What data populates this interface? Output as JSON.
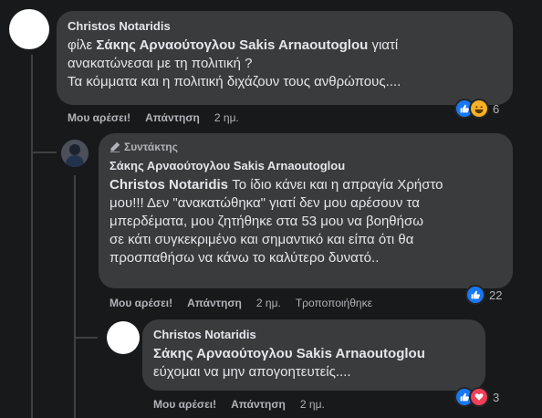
{
  "comment1": {
    "author": "Christos Notaridis",
    "line1_prefix": "φίλε ",
    "line1_mention": "Σάκης Αρναούτογλου Sakis Arnaoutoglou",
    "line1_suffix": " γιατί",
    "line2": "ανακατώνεσαι με τη πολιτική ?",
    "line3": "Τα κόμματα και η πολιτική διχάζουν τους ανθρώπους....",
    "like_label": "Μου αρέσει!",
    "reply_label": "Απάντηση",
    "time": "2 ημ.",
    "reaction_count": "6"
  },
  "reply1": {
    "badge": "Συντάκτης",
    "author": "Σάκης Αρναούτογλου Sakis Arnaoutoglou",
    "mention": "Christos Notaridis",
    "line1_suffix": " Το ίδιο κάνει και η απραγία Χρήστο",
    "line2": "μου!!! Δεν \"ανακατώθηκα\" γιατί δεν μου αρέσουν τα",
    "line3": "μπερδέματα, μου ζητήθηκε στα 53 μου να βοηθήσω",
    "line4": "σε κάτι συγκεκριμένο και σημαντικό και είπα ότι θα",
    "line5": "προσπαθήσω να κάνω το καλύτερο δυνατό..",
    "like_label": "Μου αρέσει!",
    "reply_label": "Απάντηση",
    "time": "2 ημ.",
    "edited": "Τροποποιήθηκε",
    "reaction_count": "22"
  },
  "reply2": {
    "author": "Christos Notaridis",
    "mention": "Σάκης Αρναούτογλου Sakis Arnaoutoglou",
    "line2": "εύχομαι να μην απογοητευτείς....",
    "like_label": "Μου αρέσει!",
    "reply_label": "Απάντηση",
    "time": "2 ημ.",
    "reaction_count": "3"
  },
  "colors": {
    "background": "#18191a",
    "bubble": "#3a3b3c",
    "like": "#1877f2",
    "love": "#f33e58",
    "haha": "#f7b125"
  },
  "icons": [
    "like-reaction-icon",
    "haha-reaction-icon",
    "love-reaction-icon",
    "pencil-icon"
  ]
}
